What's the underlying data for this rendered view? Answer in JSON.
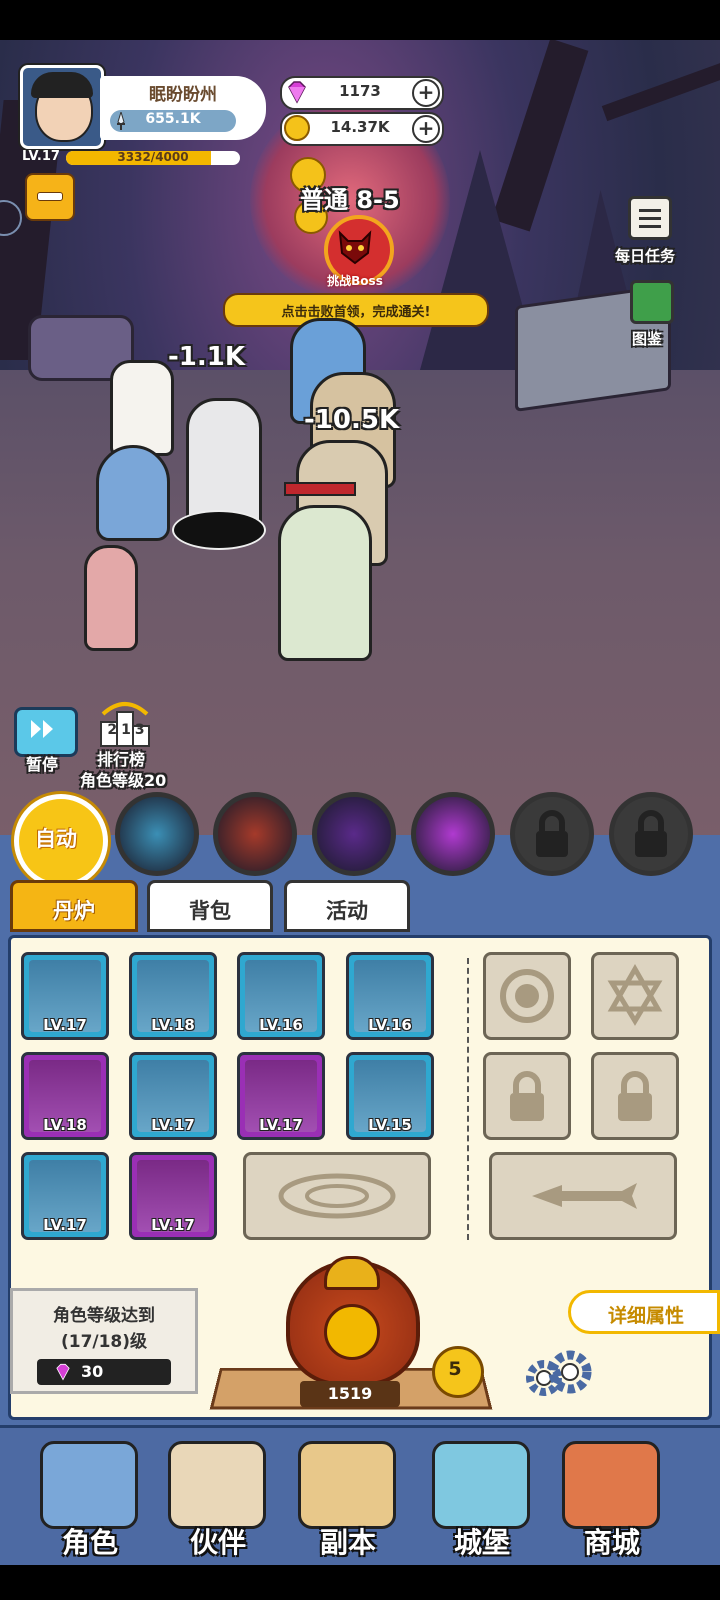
{
  "player": {
    "name": "眠盼盼州",
    "power": "655.1K",
    "level_label": "LV.17",
    "xp_text": "3332/4000",
    "xp_progress": 0.833
  },
  "currency": {
    "gems": "1173",
    "coins": "14.37K",
    "gem_color": "#d63fd6",
    "coin_color": "#f4c21a"
  },
  "stage": {
    "label": "普通 8-5",
    "boss_button": "挑战Boss",
    "tip": "点击击败首领，完成通关!"
  },
  "side_menu": {
    "daily_tasks": "每日任务",
    "codex": "图鉴"
  },
  "damage_numbers": [
    "-1.1K",
    "-10.5K"
  ],
  "controls": {
    "pause": "暂停",
    "ranking": "排行榜",
    "ranking_req": "角色等级20",
    "ranking_podium": "213"
  },
  "skills": {
    "auto": "自动",
    "items": [
      {
        "icon": "ice-beast-icon",
        "locked": false,
        "color": "#3b8fb5"
      },
      {
        "icon": "fire-beast-icon",
        "locked": false,
        "color": "#a53a2a"
      },
      {
        "icon": "vortex-icon",
        "locked": false,
        "color": "#5a2a8a"
      },
      {
        "icon": "lightning-icon",
        "locked": false,
        "color": "#b03ad0"
      },
      {
        "icon": "lock-icon",
        "locked": true,
        "color": "#3a3a3a"
      },
      {
        "icon": "lock-icon",
        "locked": true,
        "color": "#3a3a3a"
      }
    ]
  },
  "tabs": [
    {
      "label": "丹炉",
      "active": true
    },
    {
      "label": "背包",
      "active": false
    },
    {
      "label": "活动",
      "active": false
    }
  ],
  "equipment": [
    {
      "name": "spear-icon",
      "level": "LV.17",
      "rarity": "blue"
    },
    {
      "name": "helmet-icon",
      "level": "LV.18",
      "rarity": "blue"
    },
    {
      "name": "robe-icon",
      "level": "LV.16",
      "rarity": "blue"
    },
    {
      "name": "dragon-orb-icon",
      "level": "LV.16",
      "rarity": "blue"
    },
    {
      "name": "sword-icon",
      "level": "LV.18",
      "rarity": "purple"
    },
    {
      "name": "jade-icon",
      "level": "LV.17",
      "rarity": "blue"
    },
    {
      "name": "gourd-icon",
      "level": "LV.17",
      "rarity": "purple"
    },
    {
      "name": "blue-orb-icon",
      "level": "LV.15",
      "rarity": "blue"
    },
    {
      "name": "belt-icon",
      "level": "LV.17",
      "rarity": "blue"
    },
    {
      "name": "boots-icon",
      "level": "LV.17",
      "rarity": "purple"
    }
  ],
  "special_slots": [
    "emblem-icon",
    "star-emblem-icon",
    "lock-icon",
    "lock-icon",
    "array-icon",
    "weapon-rune-icon"
  ],
  "furnace": {
    "requirement_line1": "角色等级达到",
    "requirement_line2": "(17/18)级",
    "upgrade_cost": "30",
    "furnace_value": "1519",
    "furnace_level": "5",
    "detail_button": "详细属性"
  },
  "nav": [
    {
      "label": "角色",
      "icon": "character-icon",
      "color": "#7aa7d8"
    },
    {
      "label": "伙伴",
      "icon": "partner-icon",
      "color": "#e9d7b8"
    },
    {
      "label": "副本",
      "icon": "dungeon-scroll-icon",
      "color": "#e8c88a"
    },
    {
      "label": "城堡",
      "icon": "castle-icon",
      "color": "#7fc8e0"
    },
    {
      "label": "商城",
      "icon": "shop-icon",
      "color": "#e0784a"
    }
  ]
}
